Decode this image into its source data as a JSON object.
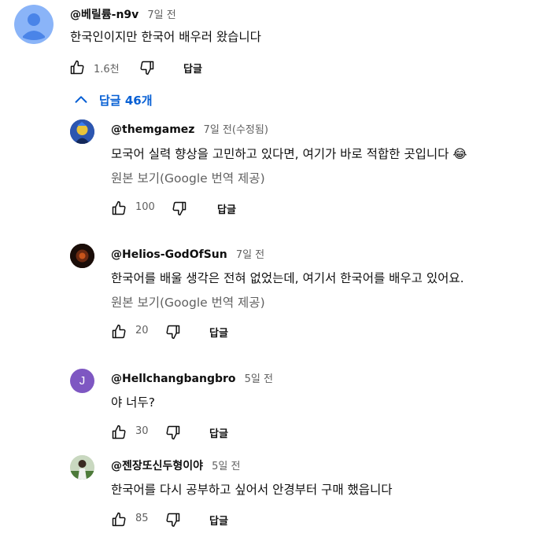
{
  "comment": {
    "author": "@베릴륨-n9v",
    "time": "7일 전",
    "text": "한국인이지만 한국어 배우러 왔습니다",
    "likes": "1.6천",
    "reply_label": "답글",
    "avatar_color": "#8ab4f8"
  },
  "replies_toggle": {
    "label": "답글 46개",
    "color": "#065fd4"
  },
  "replies": [
    {
      "author": "@themgamez",
      "time": "7일 전(수정됨)",
      "text": "모국어 실력 향상을 고민하고 있다면, 여기가 바로 적합한 곳입니다 😂",
      "translate": "원본 보기(Google 번역 제공)",
      "likes": "100",
      "reply_label": "답글"
    },
    {
      "author": "@Helios-GodOfSun",
      "time": "7일 전",
      "text": "한국어를 배울 생각은 전혀 없었는데, 여기서 한국어를 배우고 있어요.",
      "translate": "원본 보기(Google 번역 제공)",
      "likes": "20",
      "reply_label": "답글"
    },
    {
      "author": "@Hellchangbangbro",
      "time": "5일 전",
      "text": "야 너두?",
      "avatar_letter": "J",
      "avatar_color": "#7e57c2",
      "likes": "30",
      "reply_label": "답글"
    },
    {
      "author": "@젠장또신두형이야",
      "time": "5일 전",
      "text": "한국어를 다시 공부하고 싶어서 안경부터 구매 했읍니다",
      "likes": "85",
      "reply_label": "답글"
    }
  ]
}
